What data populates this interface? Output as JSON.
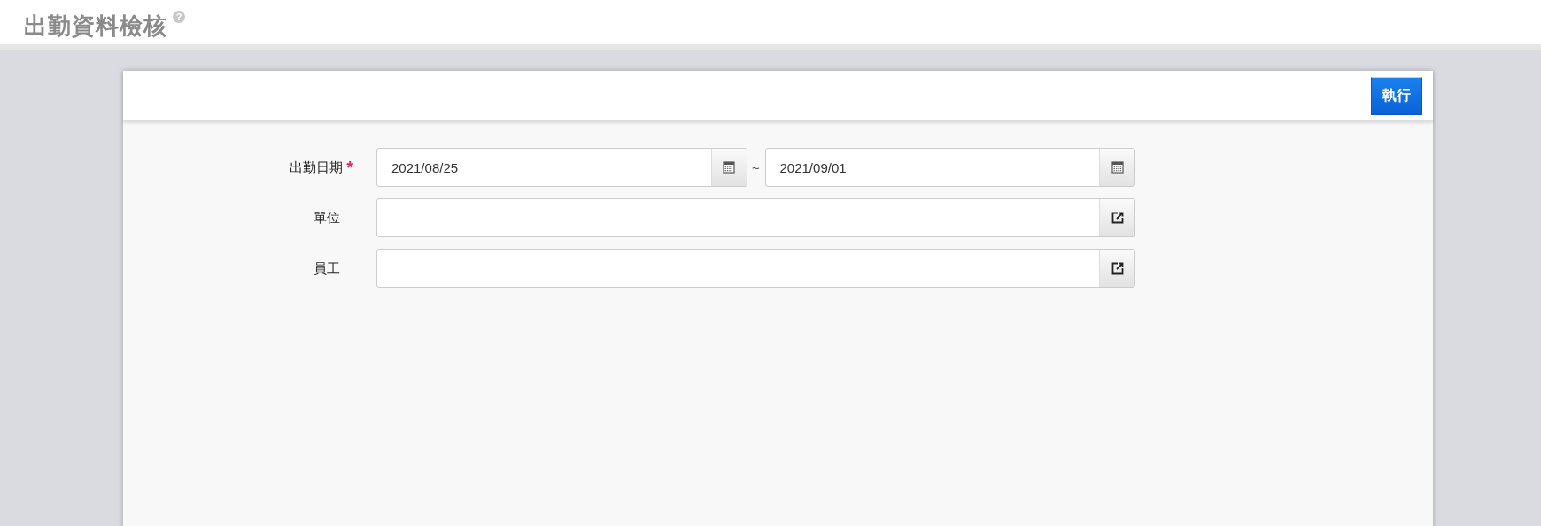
{
  "page": {
    "title": "出勤資料檢核",
    "help": "?"
  },
  "toolbar": {
    "buttons": [
      "執行"
    ]
  },
  "form": {
    "fields": [
      {
        "kind": "date_range",
        "label": "出勤日期",
        "required_mark": "*",
        "from": "2021/08/25",
        "separator": "~",
        "to": "2021/09/01"
      },
      {
        "kind": "picker",
        "label": "單位"
      },
      {
        "kind": "picker",
        "label": "員工"
      }
    ]
  }
}
